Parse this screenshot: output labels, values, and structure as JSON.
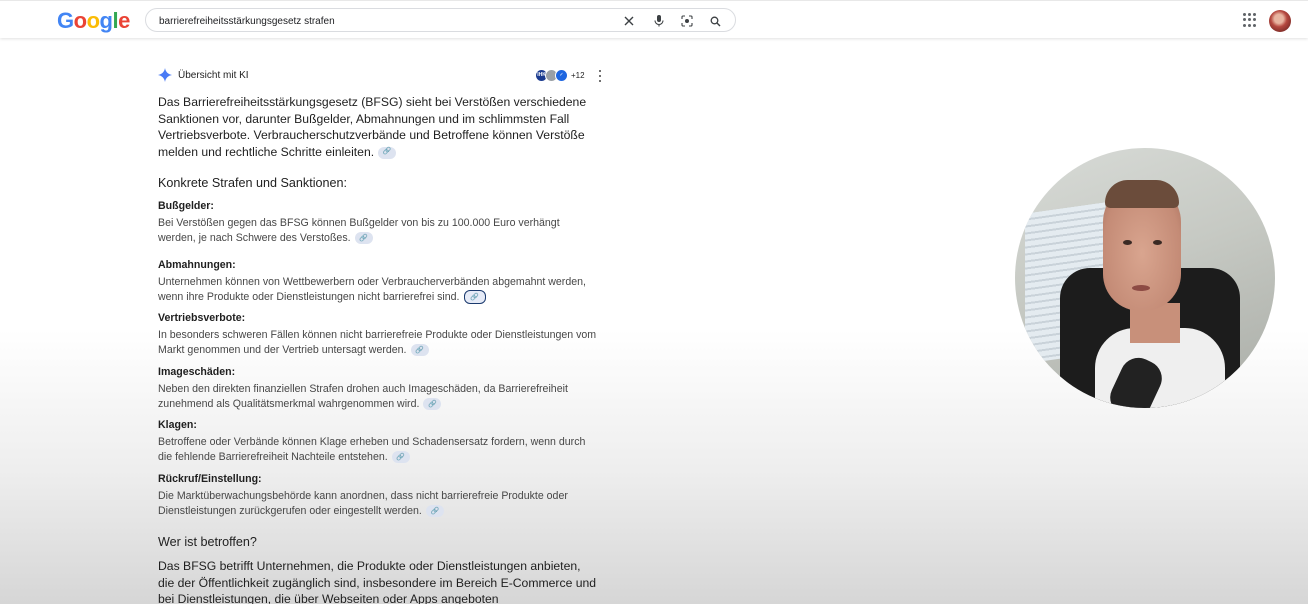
{
  "header": {
    "logo": "Google",
    "search_value": "barrierefreiheitsstärkungsgesetz strafen"
  },
  "ai_overview": {
    "title": "Übersicht mit KI",
    "source_badge": "IHK",
    "source_count": "+12",
    "intro": "Das Barrierefreiheitsstärkungsgesetz (BFSG) sieht bei Verstößen verschiedene Sanktionen vor, darunter Bußgelder, Abmahnungen und im schlimmsten Fall Vertriebsverbote. Verbraucherschutzverbände und Betroffene können Verstöße melden und rechtliche Schritte einleiten.",
    "section_heading": "Konkrete Strafen und Sanktionen:",
    "items": [
      {
        "heading": "Bußgelder:",
        "text": "Bei Verstößen gegen das BFSG können Bußgelder von bis zu 100.000 Euro verhängt werden, je nach Schwere des Verstoßes."
      },
      {
        "heading": "Abmahnungen:",
        "text": "Unternehmen können von Wettbewerbern oder Verbraucherverbänden abgemahnt werden, wenn ihre Produkte oder Dienstleistungen nicht barrierefrei sind."
      },
      {
        "heading": "Vertriebsverbote:",
        "text": "In besonders schweren Fällen können nicht barrierefreie Produkte oder Dienstleistungen vom Markt genommen und der Vertrieb untersagt werden."
      },
      {
        "heading": "Imageschäden:",
        "text": "Neben den direkten finanziellen Strafen drohen auch Imageschäden, da Barrierefreiheit zunehmend als Qualitätsmerkmal wahrgenommen wird."
      },
      {
        "heading": "Klagen:",
        "text": "Betroffene oder Verbände können Klage erheben und Schadensersatz fordern, wenn durch die fehlende Barrierefreiheit Nachteile entstehen."
      },
      {
        "heading": "Rückruf/Einstellung:",
        "text": "Die Marktüberwachungsbehörde kann anordnen, dass nicht barrierefreie Produkte oder Dienstleistungen zurückgerufen oder eingestellt werden."
      }
    ],
    "who_heading": "Wer ist betroffen?",
    "who_text": "Das BFSG betrifft Unternehmen, die Produkte oder Dienstleistungen anbieten, die der Öffentlichkeit zugänglich sind, insbesondere im Bereich E-Commerce und bei Dienstleistungen, die über Webseiten oder Apps angeboten"
  },
  "colors": {
    "logo_blue": "#4285f4",
    "logo_red": "#ea4335",
    "logo_yellow": "#fbbc05",
    "logo_green": "#34a853",
    "link_chip": "#dde3f0"
  },
  "icons": [
    "clear-icon",
    "mic-icon",
    "lens-icon",
    "search-icon",
    "apps-icon",
    "spark-icon",
    "link-icon",
    "more-vert-icon"
  ]
}
